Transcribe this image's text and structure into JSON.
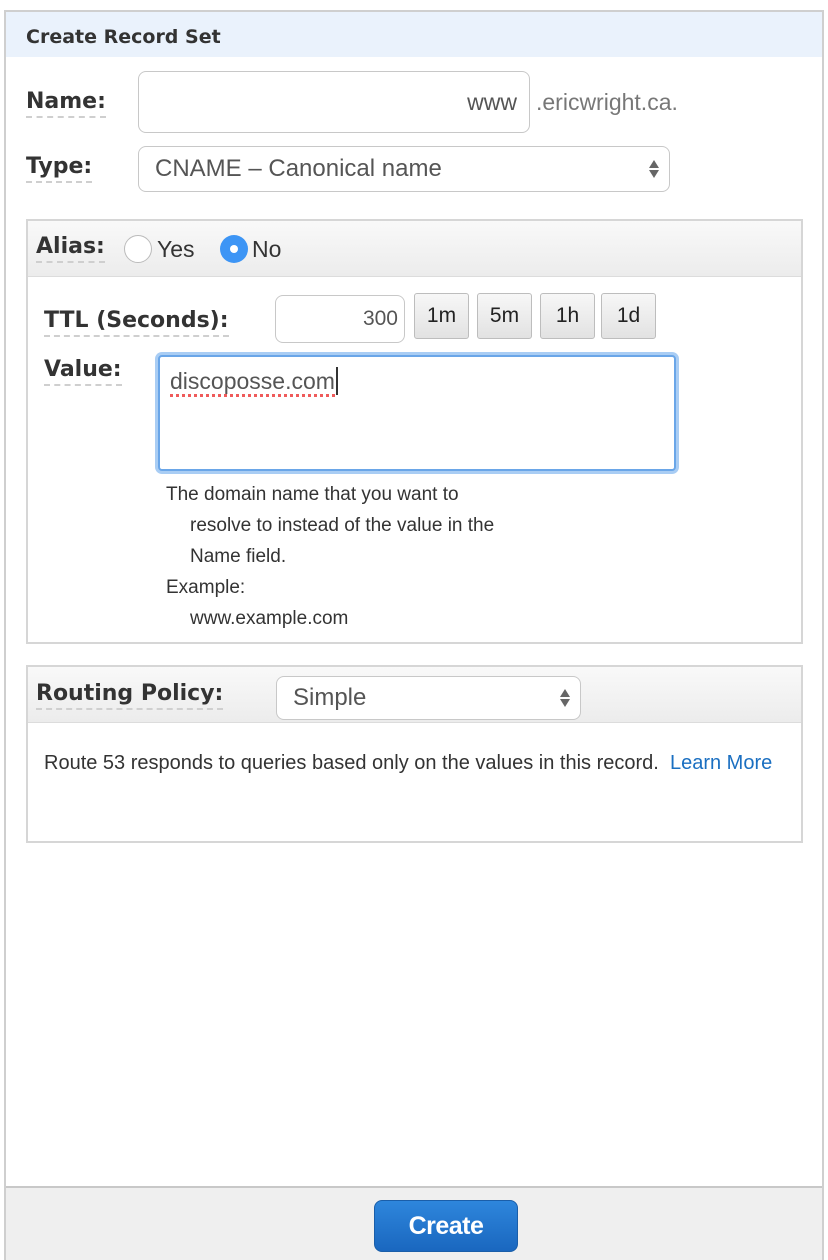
{
  "panel": {
    "title": "Create Record Set"
  },
  "name": {
    "label": "Name:",
    "value": "www",
    "suffix": ".ericwright.ca."
  },
  "type": {
    "label": "Type:",
    "selected": "CNAME – Canonical name"
  },
  "alias": {
    "label": "Alias:",
    "options": [
      {
        "label": "Yes",
        "selected": false
      },
      {
        "label": "No",
        "selected": true
      }
    ]
  },
  "ttl": {
    "label": "TTL (Seconds):",
    "value": "300",
    "presets": [
      "1m",
      "5m",
      "1h",
      "1d"
    ]
  },
  "value": {
    "label": "Value:",
    "text": "discoposse.com",
    "help": {
      "line1": "The domain name that you want to",
      "line2": "resolve to instead of the value in the",
      "line3": "Name field.",
      "example_label": "Example:",
      "example_value": "www.example.com"
    }
  },
  "routing": {
    "label": "Routing Policy:",
    "selected": "Simple",
    "description": "Route 53 responds to queries based only on the values in this record.",
    "link_text": "Learn More"
  },
  "footer": {
    "create_label": "Create"
  },
  "colors": {
    "accent": "#3d95f5",
    "button": "#1a6fc1",
    "link": "#1a6fc1",
    "header_bg": "#eaf2fc"
  }
}
